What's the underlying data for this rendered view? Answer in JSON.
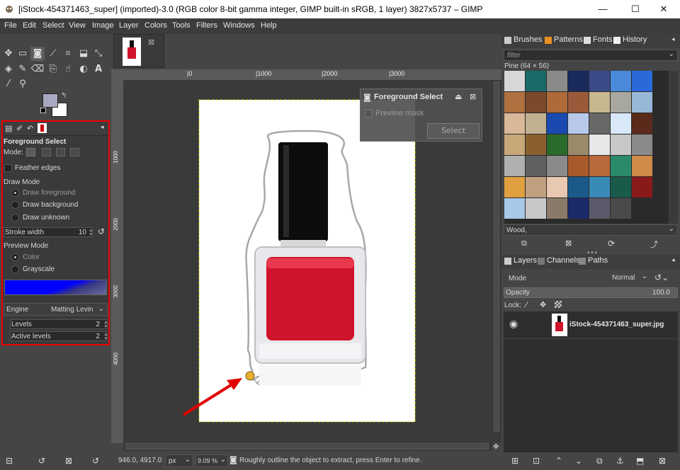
{
  "window": {
    "title": "[iStock-454371463_super] (imported)-3.0 (RGB color 8-bit gamma integer, GIMP built-in sRGB, 1 layer) 3827x5737 – GIMP",
    "minimize": "—",
    "maximize": "☐",
    "close": "✕"
  },
  "menu": [
    "File",
    "Edit",
    "Select",
    "View",
    "Image",
    "Layer",
    "Colors",
    "Tools",
    "Filters",
    "Windows",
    "Help"
  ],
  "tool_options": {
    "title": "Foreground Select",
    "mode_label": "Mode:",
    "feather_edges": "Feather edges",
    "draw_mode_label": "Draw Mode",
    "draw_modes": [
      "Draw foreground",
      "Draw background",
      "Draw unknown"
    ],
    "stroke_width_label": "Stroke width",
    "stroke_width_value": "10",
    "preview_mode_label": "Preview Mode",
    "preview_modes": [
      "Color",
      "Grayscale"
    ],
    "engine_label": "Engine",
    "engine_value": "Matting Levin",
    "levels_label": "Levels",
    "levels_value": "2",
    "active_levels_label": "Active levels",
    "active_levels_value": "2"
  },
  "ruler": {
    "h_ticks": [
      "|0",
      "|1000",
      "|2000",
      "|3000"
    ],
    "v_ticks": [
      "1000",
      "2000",
      "3000",
      "4000"
    ]
  },
  "fg_dialog": {
    "title": "Foreground Select",
    "preview_mask": "Preview mask",
    "select_button": "Select"
  },
  "status": {
    "coords": "946.0, 4917.0",
    "unit": "px",
    "zoom": "9.09 %",
    "message": "Roughly outline the object to extract, press Enter to refine."
  },
  "dock_top": {
    "tabs": [
      "Brushes",
      "Patterns",
      "Fonts",
      "History"
    ],
    "filter_placeholder": "filter",
    "pattern_label": "Pine (64 × 56)",
    "selected_pattern": "Wood,"
  },
  "layers": {
    "tabs": [
      "Layers",
      "Channels",
      "Paths"
    ],
    "mode_label": "Mode",
    "mode_value": "Normal",
    "opacity_label": "Opacity",
    "opacity_value": "100.0",
    "lock_label": "Lock:",
    "layer_name": "iStock-454371463_super.jpg"
  },
  "colors": {
    "accent_red": "#e00000",
    "progress_blue": "#0000ff",
    "bottle_red": "#d0142c"
  }
}
